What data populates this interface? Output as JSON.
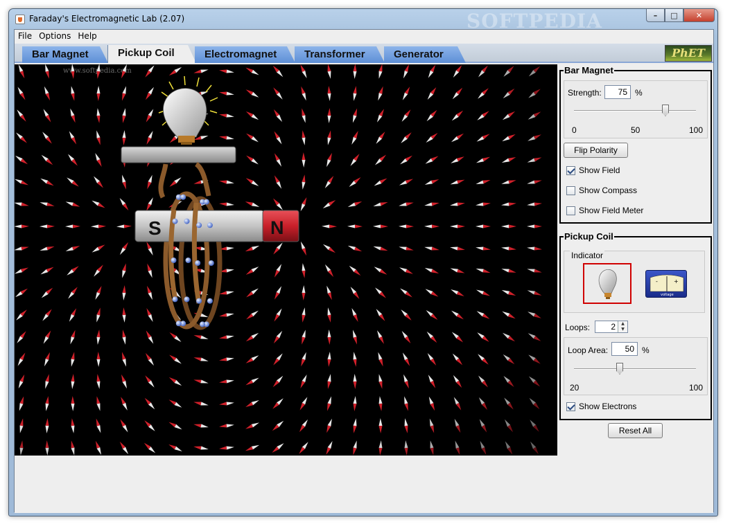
{
  "window": {
    "title": "Faraday's Electromagnetic Lab (2.07)",
    "overlay_watermark": "SOFTPEDIA"
  },
  "window_buttons": {
    "minimize": "–",
    "maximize": "□",
    "close": "✕"
  },
  "menu": [
    "File",
    "Options",
    "Help"
  ],
  "tabs": [
    {
      "label": "Bar Magnet",
      "active": false
    },
    {
      "label": "Pickup Coil",
      "active": true
    },
    {
      "label": "Electromagnet",
      "active": false
    },
    {
      "label": "Transformer",
      "active": false
    },
    {
      "label": "Generator",
      "active": false
    }
  ],
  "logo": "PhET",
  "canvas": {
    "watermark": "www.softpedia.com",
    "magnet": {
      "south_label": "S",
      "north_label": "N"
    },
    "meter_label": "voltage"
  },
  "bar_magnet_panel": {
    "title": "Bar Magnet",
    "strength_label": "Strength:",
    "strength_value": "75",
    "strength_unit": "%",
    "strength_fraction": 0.75,
    "ticks": [
      "0",
      "50",
      "100"
    ],
    "flip_button": "Flip Polarity",
    "checkboxes": [
      {
        "label": "Show Field",
        "checked": true
      },
      {
        "label": "Show Compass",
        "checked": false
      },
      {
        "label": "Show Field Meter",
        "checked": false
      }
    ]
  },
  "pickup_coil_panel": {
    "title": "Pickup Coil",
    "indicator_label": "Indicator",
    "indicator_selected": "lightbulb",
    "loops_label": "Loops:",
    "loops_value": "2",
    "loop_area_label": "Loop Area:",
    "loop_area_value": "50",
    "loop_area_unit": "%",
    "loop_area_fraction": 0.375,
    "ticks": [
      "20",
      "100"
    ],
    "show_electrons": {
      "label": "Show Electrons",
      "checked": true
    }
  },
  "reset_button": "Reset All",
  "colors": {
    "tab_blue": "#6f9ee0",
    "magnet_north": "#c8202a",
    "magnet_south": "#cfcfcf",
    "coil": "#8b5a2b",
    "electron": "#7fa0e8",
    "indicator_border": "#d00000"
  }
}
